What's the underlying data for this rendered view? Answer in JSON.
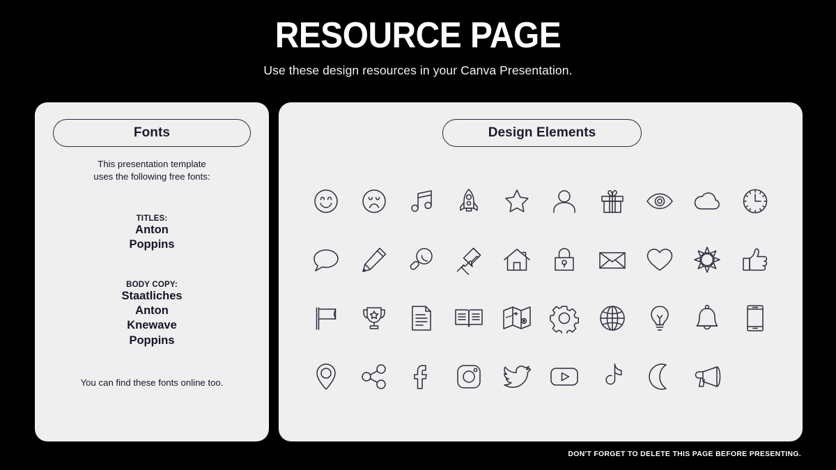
{
  "header": {
    "title": "RESOURCE PAGE",
    "subtitle": "Use these design resources in your Canva Presentation."
  },
  "fonts_panel": {
    "pill_label": "Fonts",
    "intro_line_1": "This presentation template",
    "intro_line_2": "uses the following free fonts:",
    "titles_group": {
      "label": "TITLES:",
      "fonts": [
        "Anton",
        "Poppins"
      ]
    },
    "body_group": {
      "label": "BODY COPY:",
      "fonts": [
        "Staatliches",
        "Anton",
        "Knewave",
        "Poppins"
      ]
    },
    "closing_line": "You can find these fonts online too."
  },
  "elements_panel": {
    "pill_label": "Design Elements",
    "icons": [
      "smiley-face-icon",
      "sad-face-icon",
      "music-note-icon",
      "rocket-icon",
      "star-icon",
      "person-icon",
      "gift-icon",
      "eye-icon",
      "cloud-icon",
      "clock-icon",
      "speech-bubble-icon",
      "pencil-icon",
      "magnifying-glass-icon",
      "pushpin-icon",
      "house-icon",
      "lock-icon",
      "envelope-icon",
      "heart-icon",
      "sun-icon",
      "thumbs-up-icon",
      "flag-icon",
      "trophy-icon",
      "document-icon",
      "open-book-icon",
      "map-icon",
      "gear-icon",
      "globe-icon",
      "lightbulb-icon",
      "bell-icon",
      "smartphone-icon",
      "location-pin-icon",
      "share-icon",
      "facebook-icon",
      "instagram-icon",
      "twitter-icon",
      "youtube-icon",
      "tiktok-icon",
      "moon-icon",
      "megaphone-icon"
    ]
  },
  "footer": {
    "note": "DON'T FORGET TO DELETE THIS PAGE BEFORE PRESENTING."
  },
  "colors": {
    "background": "#000000",
    "panel": "#efefef",
    "text_dark": "#15152a",
    "pill_border": "#2b2b40",
    "icon_stroke": "#2d2d3d",
    "header_text": "#ffffff"
  }
}
